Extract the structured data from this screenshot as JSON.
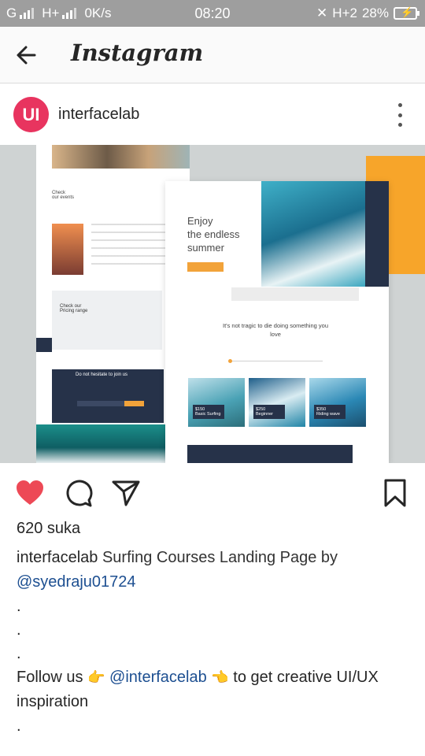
{
  "status_bar": {
    "carrier1": "G",
    "carrier2": "H+",
    "speed": "0K/s",
    "time": "08:20",
    "network": "H+2",
    "battery": "28%"
  },
  "app": {
    "title": "Instagram"
  },
  "post": {
    "avatar_initials": "UI",
    "username": "interfacelab",
    "image": {
      "hero_text": "Enjoy\nthe endless\nsummer",
      "events_title": "Check\nour events",
      "pricing_title": "Check our\nPricing range",
      "cta_text": "Do not hesitate to join us",
      "tagline": "It's not tragic to die doing something you love",
      "courses": [
        {
          "price": "$150",
          "name": "Basic Surfing"
        },
        {
          "price": "$250",
          "name": "Beginner"
        },
        {
          "price": "$350",
          "name": "Riding wave"
        }
      ]
    },
    "likes": "620 suka",
    "caption": {
      "username": "interfacelab",
      "text": "Surfing Courses Landing Page by",
      "mention": "@syedraju01724",
      "dot": ".",
      "follow_prefix": "Follow us",
      "follow_emoji_left": "👉",
      "follow_mention": "@interfacelab",
      "follow_emoji_right": "👈",
      "follow_suffix": "to get creative UI/UX inspiration"
    }
  },
  "icons": {
    "back": "arrow-left-icon",
    "more": "more-vertical-icon",
    "like": "heart-icon",
    "comment": "comment-icon",
    "share": "send-icon",
    "save": "bookmark-icon"
  },
  "colors": {
    "like_active": "#ed4956",
    "avatar_bg": "#e8345f",
    "mention": "#1d4f91",
    "status_bar": "#9e9e9e"
  }
}
